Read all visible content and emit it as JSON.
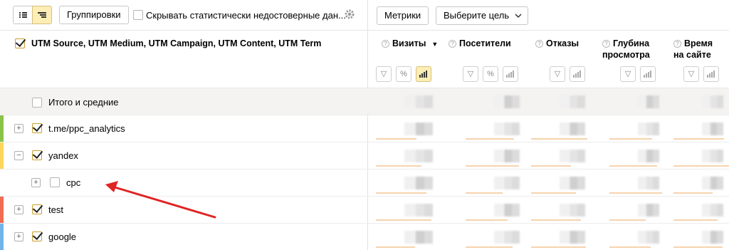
{
  "toolbar": {
    "view_flat_icon": "list-icon",
    "view_tree_icon": "tree-list-icon",
    "groupings_label": "Группировки",
    "hide_unreliable_label": "Скрывать статистически недостоверные дан...",
    "settings_icon": "gear-icon",
    "metrics_label": "Метрики",
    "goal_select_label": "Выберите цель"
  },
  "table": {
    "dimension_header": "UTM Source, UTM Medium, UTM Campaign, UTM Content, UTM Term",
    "metrics": [
      {
        "name": "Визиты",
        "sorted": true
      },
      {
        "name": "Посетители"
      },
      {
        "name": "Отказы"
      },
      {
        "name": "Глубина просмотра"
      },
      {
        "name": "Время на сайте"
      }
    ],
    "total_label": "Итого и средние",
    "rows": [
      {
        "label": "t.me/ppc_analytics",
        "checked": true,
        "expander": "+",
        "stripe": "#8bc34a"
      },
      {
        "label": "yandex",
        "checked": true,
        "expander": "−",
        "stripe": "#fbd65a"
      },
      {
        "label": "cpc",
        "checked": false,
        "expander": "+",
        "stripe": ""
      },
      {
        "label": "test",
        "checked": true,
        "expander": "+",
        "stripe": "#f26b53"
      },
      {
        "label": "google",
        "checked": true,
        "expander": "+",
        "stripe": "#72b4ea"
      }
    ]
  },
  "colors": {
    "accent_yellow": "#fdeeb6",
    "arrow_red": "#e02424"
  }
}
